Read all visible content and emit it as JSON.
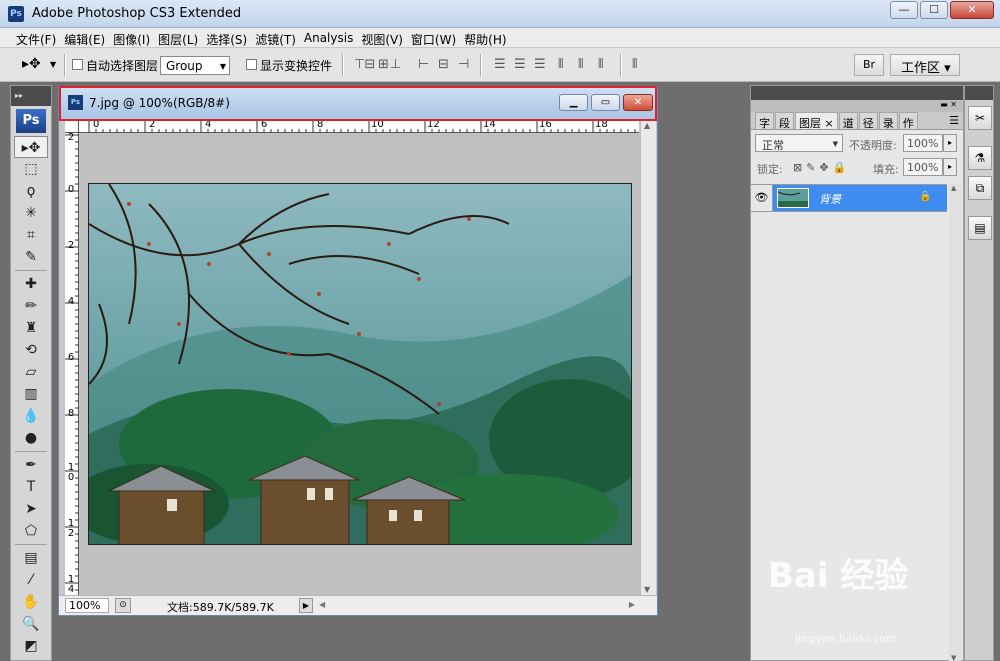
{
  "app": {
    "title": "Adobe Photoshop CS3 Extended",
    "icon_text": "Ps",
    "window_controls": [
      "minimize",
      "maximize",
      "close"
    ]
  },
  "menu": [
    "文件(F)",
    "编辑(E)",
    "图像(I)",
    "图层(L)",
    "选择(S)",
    "滤镜(T)",
    "Analysis",
    "视图(V)",
    "窗口(W)",
    "帮助(H)"
  ],
  "options_bar": {
    "auto_select_label": "自动选择图层",
    "group_value": "Group",
    "show_transform_label": "显示变换控件",
    "workspace_label": "工作区 ▾",
    "bridge_label": "Br"
  },
  "toolbox": {
    "logo": "Ps",
    "tools": [
      "move-tool",
      "marquee-tool",
      "lasso-tool",
      "magic-wand-tool",
      "crop-tool",
      "slice-tool",
      "healing-brush-tool",
      "brush-tool",
      "clone-stamp-tool",
      "history-brush-tool",
      "eraser-tool",
      "gradient-tool",
      "blur-tool",
      "dodge-tool",
      "pen-tool",
      "type-tool",
      "path-selection-tool",
      "shape-tool",
      "notes-tool",
      "eyedropper-tool",
      "hand-tool",
      "zoom-tool"
    ],
    "type_glyph": "T"
  },
  "document": {
    "title": "7.jpg @ 100%(RGB/8#)",
    "icon_text": "Ps",
    "ruler_top": [
      "0",
      "2",
      "4",
      "6",
      "8",
      "10",
      "12",
      "14",
      "16",
      "18"
    ],
    "ruler_left": [
      "2",
      "0",
      "2",
      "4",
      "6",
      "8",
      "1 0",
      "1 2",
      "1 4"
    ],
    "zoom": "100%",
    "doc_info": "文档:589.7K/589.7K"
  },
  "layers_panel": {
    "tabs": [
      "字",
      "段",
      "图层",
      "×",
      "道",
      "径",
      "录",
      "作"
    ],
    "blend_mode": "正常",
    "opacity_label": "不透明度:",
    "opacity_value": "100%",
    "lock_label": "锁定:",
    "fill_label": "填充:",
    "fill_value": "100%",
    "layer_name": "背景"
  },
  "watermark": {
    "text": "Bai 经验",
    "sub": "jingyan.baidu.com"
  }
}
